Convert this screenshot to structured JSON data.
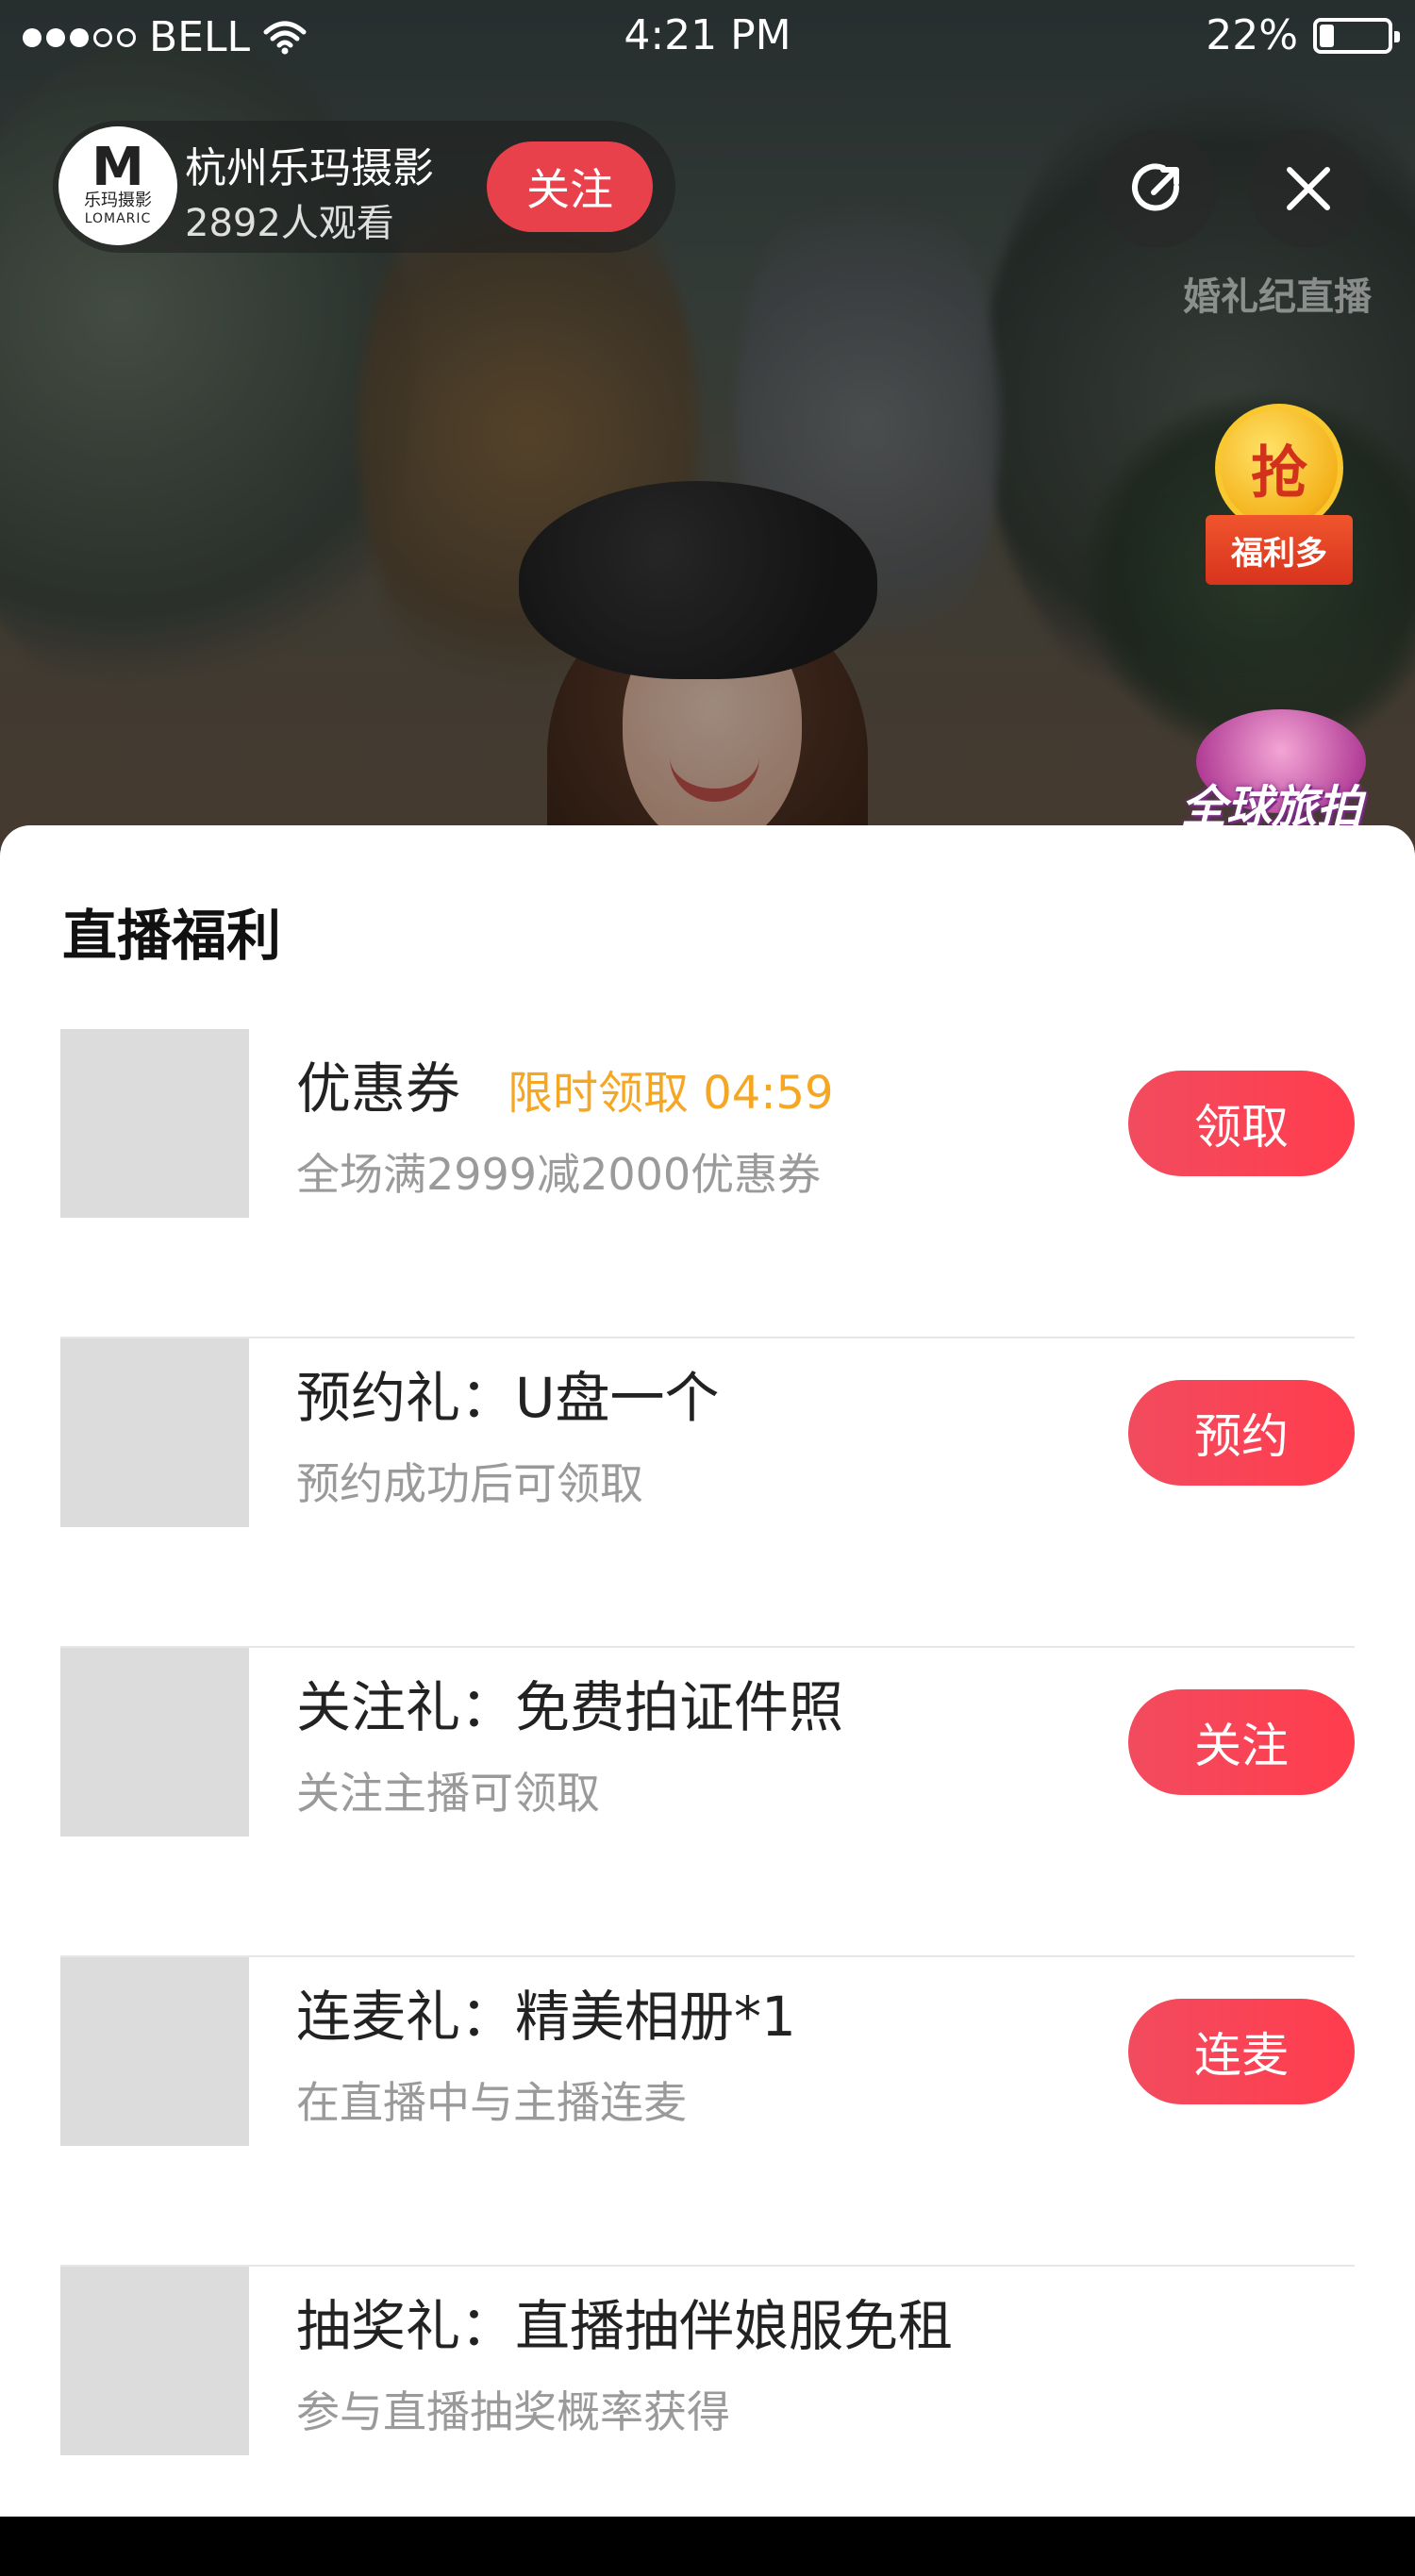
{
  "status_bar": {
    "carrier": "BELL",
    "time": "4:21 PM",
    "battery_percent": "22%",
    "battery_level": 0.22,
    "signal_icon": "signal-dots-icon",
    "wifi_icon": "wifi-icon"
  },
  "host": {
    "name": "杭州乐玛摄影",
    "viewers": "2892人观看",
    "follow_label": "关注",
    "avatar_logo": {
      "letter": "M",
      "line1": "乐玛摄影",
      "line2": "LOMARIC"
    }
  },
  "top_actions": {
    "share_icon": "share-icon",
    "close_icon": "close-icon"
  },
  "watermark": "婚礼纪直播",
  "floating_badges": {
    "welfare": {
      "coin_text": "抢",
      "label": "福利多"
    },
    "travel": {
      "label": "全球旅拍"
    }
  },
  "sheet": {
    "title": "直播福利",
    "items": [
      {
        "title": "优惠券",
        "badge": "限时领取 04:59",
        "desc": "全场满2999减2000优惠券",
        "action": "领取"
      },
      {
        "title": "预约礼：U盘一个",
        "desc": "预约成功后可领取",
        "action": "预约"
      },
      {
        "title": "关注礼：免费拍证件照",
        "desc": "关注主播可领取",
        "action": "关注"
      },
      {
        "title": "连麦礼：精美相册*1",
        "desc": "在直播中与主播连麦",
        "action": "连麦"
      },
      {
        "title": "抽奖礼：直播抽伴娘服免租",
        "desc": "参与直播抽奖概率获得"
      }
    ]
  },
  "colors": {
    "accent": "#f24b5e",
    "badge_orange": "#f5a623",
    "desc_gray": "#9a9a9a",
    "thumb_gray": "#dcdcdc"
  }
}
